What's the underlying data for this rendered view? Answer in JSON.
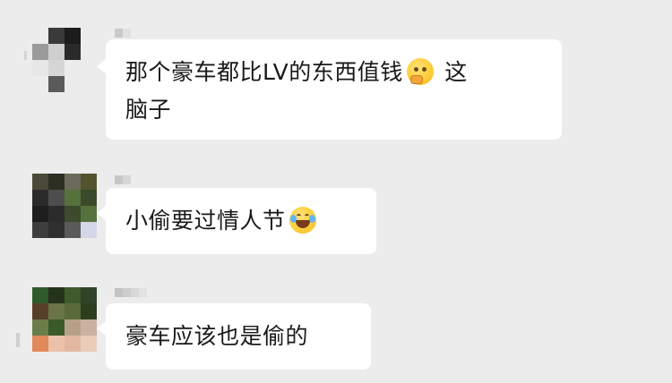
{
  "messages": [
    {
      "text_before": "那个豪车都比LV的东西值钱",
      "emoji": "thinking-face-icon",
      "text_after": " 这",
      "text_line2": "脑子"
    },
    {
      "text_before": "小偷要过情人节",
      "emoji": "rolling-laughing-face-icon"
    },
    {
      "text_before": "豪车应该也是偷的"
    }
  ],
  "avatar_palettes": {
    "a1": [
      "#ececec",
      "#3a3a3a",
      "#1c1c1c",
      "#ececec",
      "#9a9a9a",
      "#cfcfcf",
      "#2a2a2a",
      "#ececec",
      "#e7e7e7",
      "#d6d6d6",
      "#ececec",
      "#ececec",
      "#ececec",
      "#5a5a5a",
      "#ececec",
      "#ececec"
    ],
    "a2": [
      "#4a4a3a",
      "#2c2e22",
      "#6a6b5a",
      "#53542e",
      "#2b2b2b",
      "#4d4d4d",
      "#56713a",
      "#3a4a2a",
      "#1e1e1e",
      "#2b2b2b",
      "#3c4a2e",
      "#55723d",
      "#3e3e3e",
      "#2f2f2f",
      "#5a5a5a",
      "#d4d7e8"
    ],
    "a3": [
      "#2f5a2a",
      "#25331b",
      "#3f5a2c",
      "#31432a",
      "#57402a",
      "#6a7446",
      "#5b6a3a",
      "#2c3d20",
      "#6b7e4a",
      "#3a5a27",
      "#b8a088",
      "#c9b2a0",
      "#e08a5a",
      "#ebc1aa",
      "#e2b8a2",
      "#e9cdb9"
    ]
  }
}
